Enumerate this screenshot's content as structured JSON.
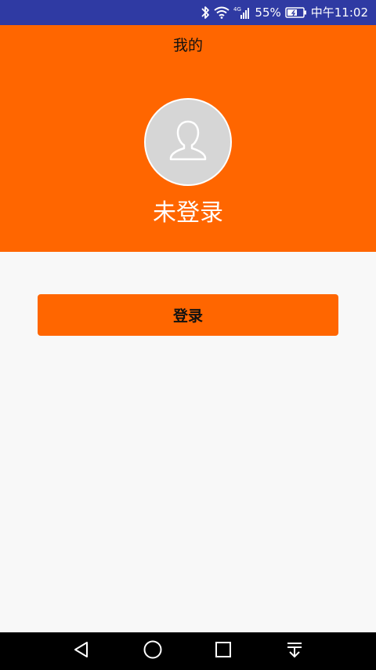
{
  "status_bar": {
    "battery_percent_text": "55%",
    "network_type": "4G",
    "time": "中午11:02",
    "icons": [
      "bluetooth-icon",
      "wifi-icon",
      "cellular-signal-icon",
      "battery-charging-icon"
    ]
  },
  "header": {
    "title": "我的",
    "avatar_icon": "user-silhouette-icon",
    "login_status": "未登录"
  },
  "main": {
    "login_button_label": "登录"
  },
  "nav_bar": {
    "buttons": [
      "back-icon",
      "home-icon",
      "recents-icon",
      "notification-pull-down-icon"
    ]
  },
  "colors": {
    "status_bar_bg": "#2f3aa3",
    "accent_orange": "#ff6600",
    "page_bg": "#f8f8f8",
    "nav_bar_bg": "#000000",
    "avatar_bg": "#d6d6d6"
  }
}
